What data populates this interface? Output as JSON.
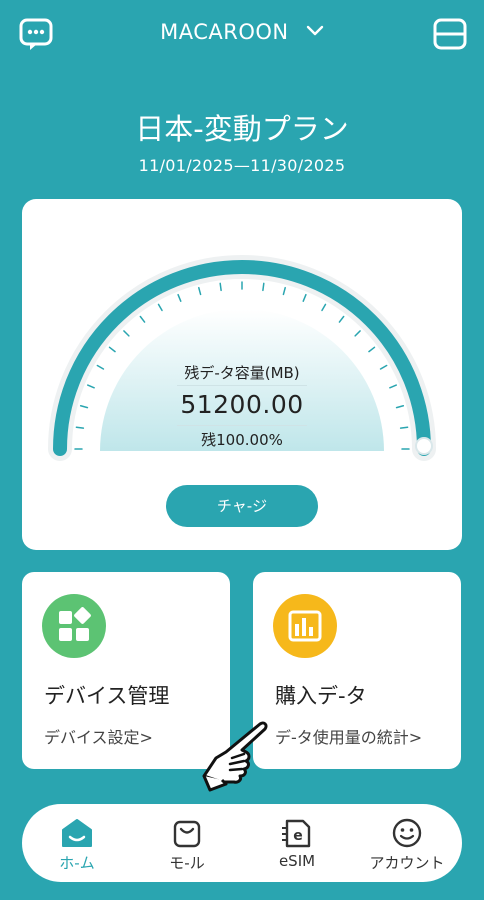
{
  "header": {
    "account_name": "MACAROON",
    "left_icon": "chat-bubble-icon",
    "right_icon": "scan-icon",
    "dropdown_icon": "chevron-down-icon"
  },
  "plan": {
    "title": "日本-変動プラン",
    "dates": "11/01/2025—11/30/2025"
  },
  "gauge": {
    "caption": "残デ-タ容量(MB)",
    "value": "51200.00",
    "percent_text": "残100.00%",
    "level": 1.0,
    "charge_label": "チャ-ジ"
  },
  "tiles": [
    {
      "title": "デバイス管理",
      "subtitle": "デバイス設定>",
      "icon": "grid-apps-icon",
      "color": "#5cc373"
    },
    {
      "title": "購入デ-タ",
      "subtitle": "デ-タ使用量の統計>",
      "icon": "bar-chart-icon",
      "color": "#f6b81b"
    }
  ],
  "nav": [
    {
      "label": "ホ-ム",
      "icon": "home-icon",
      "active": true
    },
    {
      "label": "モ-ル",
      "icon": "shopping-bag-icon",
      "active": false
    },
    {
      "label": "eSIM",
      "icon": "esim-icon",
      "active": false
    },
    {
      "label": "アカウント",
      "icon": "smiley-icon",
      "active": false
    }
  ],
  "colors": {
    "accent": "#2aa5b0",
    "green": "#5cc373",
    "yellow": "#f6b81b"
  }
}
